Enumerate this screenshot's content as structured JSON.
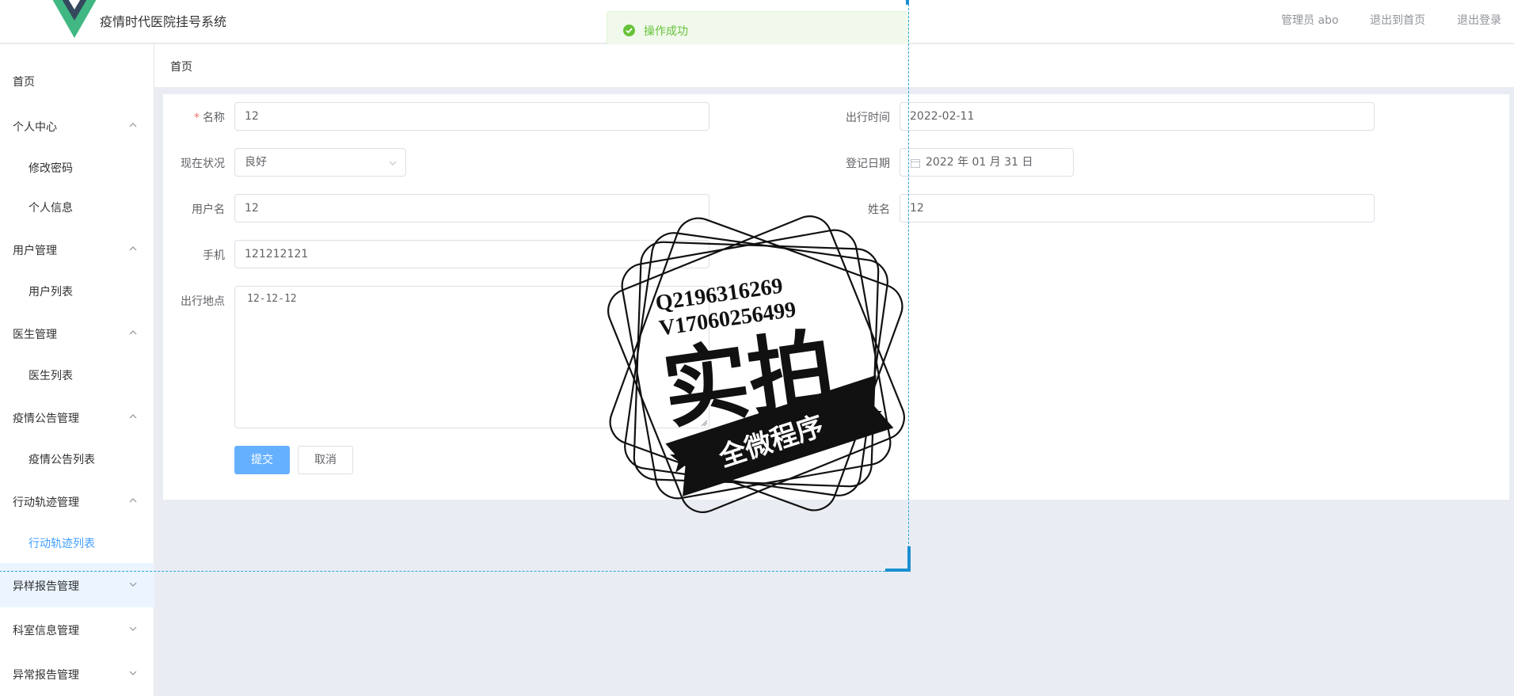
{
  "header": {
    "app_title": "疫情时代医院挂号系统",
    "user_label": "管理员 abo",
    "home_link": "退出到首页",
    "logout_link": "退出登录",
    "logo_colors": {
      "outer": "#41b883",
      "inner": "#35495e"
    }
  },
  "toast": {
    "text": "操作成功",
    "icon": "check-circle-icon",
    "color": "#67c23a"
  },
  "sidebar": {
    "home": "首页",
    "groups": [
      {
        "label": "个人中心",
        "children": [
          "修改密码",
          "个人信息"
        ]
      },
      {
        "label": "用户管理",
        "children": [
          "用户列表"
        ]
      },
      {
        "label": "医生管理",
        "children": [
          "医生列表"
        ]
      },
      {
        "label": "疫情公告管理",
        "children": [
          "疫情公告列表"
        ]
      },
      {
        "label": "行动轨迹管理",
        "children": [
          "行动轨迹列表"
        ]
      },
      {
        "label": "异样报告管理",
        "children": []
      },
      {
        "label": "科室信息管理",
        "children": []
      },
      {
        "label": "异常报告管理",
        "children": []
      }
    ],
    "active_item": "行动轨迹列表",
    "accent": "#409eff"
  },
  "breadcrumb": {
    "label": "首页"
  },
  "form": {
    "name": {
      "label": "名称",
      "value": "12",
      "required": true
    },
    "travel_time": {
      "label": "出行时间",
      "value": "2022-02-11"
    },
    "status": {
      "label": "现在状况",
      "value": "良好"
    },
    "register_date": {
      "label": "登记日期",
      "value": "2022 年 01 月 31 日"
    },
    "username": {
      "label": "用户名",
      "value": "12"
    },
    "realname": {
      "label": "姓名",
      "value": "12"
    },
    "phone": {
      "label": "手机",
      "value": "121212121"
    },
    "location": {
      "label": "出行地点",
      "value": "12-12-12"
    },
    "submit": "提交",
    "cancel": "取消"
  },
  "watermark": {
    "line1": "Q2196316269",
    "line2": "V17060256499",
    "big": "实拍",
    "ribbon": "全微程序"
  }
}
